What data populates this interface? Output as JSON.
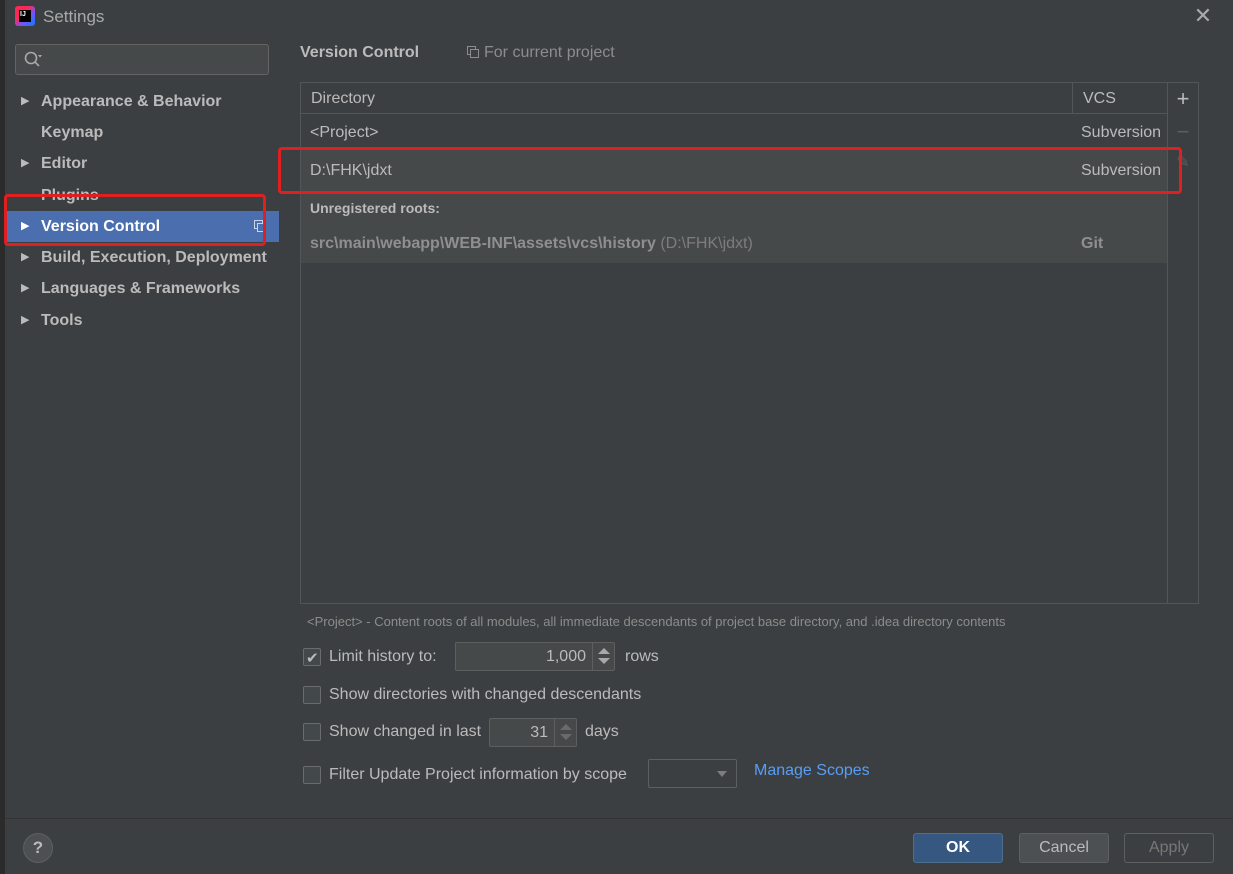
{
  "window": {
    "title": "Settings"
  },
  "sidebar": {
    "search_placeholder": "",
    "items": [
      {
        "label": "Appearance & Behavior",
        "has_arrow": true
      },
      {
        "label": "Keymap",
        "has_arrow": false
      },
      {
        "label": "Editor",
        "has_arrow": true
      },
      {
        "label": "Plugins",
        "has_arrow": false
      },
      {
        "label": "Version Control",
        "has_arrow": true,
        "selected": true
      },
      {
        "label": "Build, Execution, Deployment",
        "has_arrow": true
      },
      {
        "label": "Languages & Frameworks",
        "has_arrow": true
      },
      {
        "label": "Tools",
        "has_arrow": true
      }
    ]
  },
  "main": {
    "title": "Version Control",
    "scope_note": "For current project",
    "table": {
      "columns": [
        "Directory",
        "VCS"
      ],
      "rows": [
        {
          "directory": "<Project>",
          "vcs": "Subversion"
        },
        {
          "directory": "D:\\FHK\\jdxt",
          "vcs": "Subversion"
        }
      ],
      "unregistered_header": "Unregistered roots:",
      "unregistered": [
        {
          "path": "src\\main\\webapp\\WEB-INF\\assets\\vcs\\history",
          "path_note": "(D:\\FHK\\jdxt)",
          "vcs": "Git"
        }
      ]
    },
    "toolbar": {
      "add": "+",
      "remove": "−",
      "edit": "✎"
    },
    "hint": "<Project> - Content roots of all modules, all immediate descendants of project base directory, and .idea directory contents",
    "options": {
      "limit_history": {
        "label": "Limit history to:",
        "checked": true,
        "value": "1,000",
        "suffix": "rows"
      },
      "show_dirs": {
        "label": "Show directories with changed descendants",
        "checked": false
      },
      "show_changed": {
        "label": "Show changed in last",
        "checked": false,
        "value": "31",
        "suffix": "days"
      },
      "filter_scope": {
        "label": "Filter Update Project information by scope",
        "checked": false,
        "value": ""
      },
      "manage_scopes": "Manage Scopes"
    }
  },
  "buttons": {
    "help": "?",
    "ok": "OK",
    "cancel": "Cancel",
    "apply": "Apply"
  },
  "colors": {
    "selection": "#4b6eaf",
    "link": "#589df6",
    "annotation": "#e02020",
    "ok_button": "#365880"
  }
}
